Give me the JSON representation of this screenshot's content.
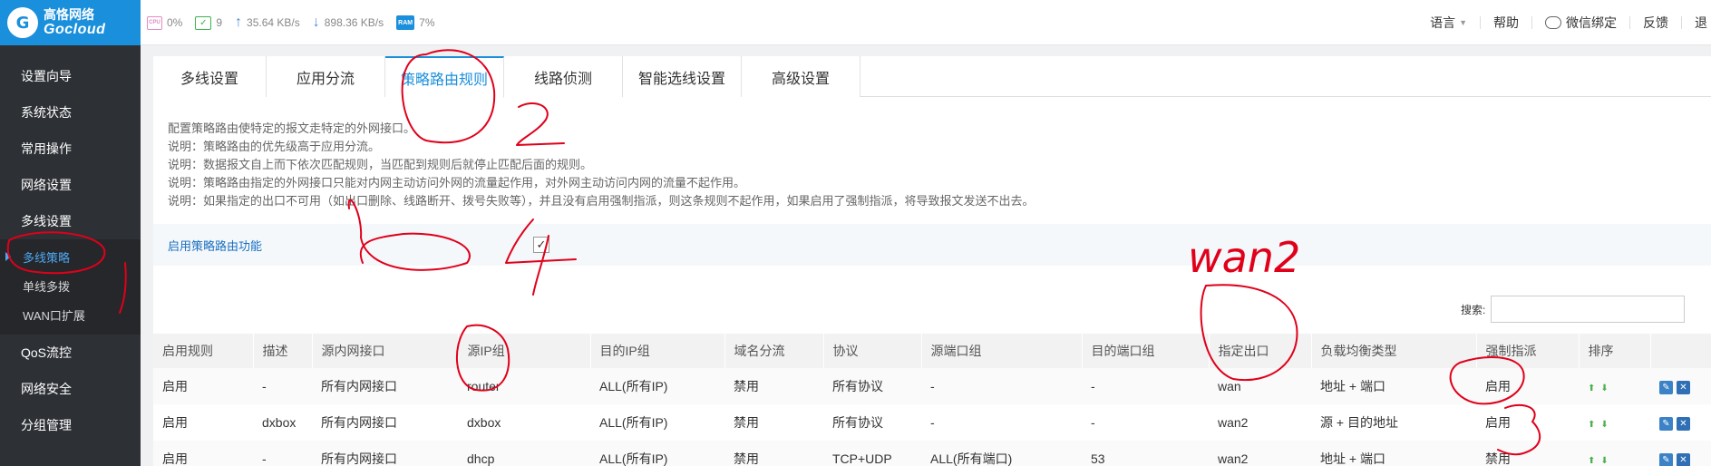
{
  "brand": {
    "cn": "高恪网络",
    "en": "Gocloud",
    "mark": "G"
  },
  "stats": {
    "cpu_icon_text": "CPU",
    "cpu": "0%",
    "devices": "9",
    "upload": "35.64 KB/s",
    "download": "898.36 KB/s",
    "ram_icon_text": "RAM",
    "ram": "7%"
  },
  "header_links": {
    "language": "语言",
    "help": "帮助",
    "wechat": "微信绑定",
    "feedback": "反馈",
    "exit": "退"
  },
  "sidebar": {
    "items": [
      "设置向导",
      "系统状态",
      "常用操作",
      "网络设置",
      "多线设置"
    ],
    "sub_items": [
      "多线策略",
      "单线多拨",
      "WAN口扩展"
    ],
    "items_after": [
      "QoS流控",
      "网络安全",
      "分组管理"
    ]
  },
  "tabs": [
    "多线设置",
    "应用分流",
    "策略路由规则",
    "线路侦测",
    "智能选线设置",
    "高级设置"
  ],
  "notes": [
    "配置策略路由使特定的报文走特定的外网接口。",
    "说明：策略路由的优先级高于应用分流。",
    "说明：数据报文自上而下依次匹配规则，当匹配到规则后就停止匹配后面的规则。",
    "说明：策略路由指定的外网接口只能对内网主动访问外网的流量起作用，对外网主动访问内网的流量不起作用。",
    "说明：如果指定的出口不可用（如出口删除、线路断开、拨号失败等），并且没有启用强制指派，则这条规则不起作用，如果启用了强制指派，将导致报文发送不出去。"
  ],
  "enable": {
    "label": "启用策略路由功能",
    "check": "✓"
  },
  "search": {
    "label": "搜索:",
    "value": ""
  },
  "table": {
    "headers": [
      "启用规则",
      "描述",
      "源内网接口",
      "源IP组",
      "目的IP组",
      "域名分流",
      "协议",
      "源端口组",
      "目的端口组",
      "指定出口",
      "负载均衡类型",
      "强制指派",
      "排序",
      ""
    ],
    "rows": [
      [
        "启用",
        "-",
        "所有内网接口",
        "router",
        "ALL(所有IP)",
        "禁用",
        "所有协议",
        "-",
        "-",
        "wan",
        "地址 + 端口",
        "启用"
      ],
      [
        "启用",
        "dxbox",
        "所有内网接口",
        "dxbox",
        "ALL(所有IP)",
        "禁用",
        "所有协议",
        "-",
        "-",
        "wan2",
        "源 + 目的地址",
        "启用"
      ],
      [
        "启用",
        "-",
        "所有内网接口",
        "dhcp",
        "ALL(所有IP)",
        "禁用",
        "TCP+UDP",
        "ALL(所有端口)",
        "53",
        "wan2",
        "地址 + 端口",
        "禁用"
      ]
    ],
    "sort_symbols": "⬆⬇",
    "action_symbols": {
      "edit": "✎",
      "delete": "✕"
    }
  },
  "annotation_text": "wan2"
}
